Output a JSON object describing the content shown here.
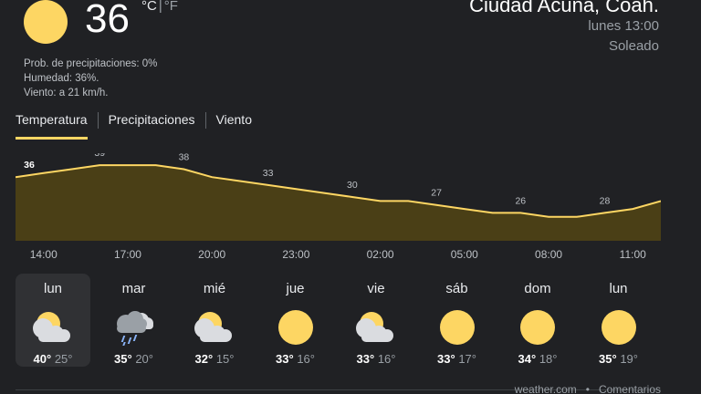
{
  "current": {
    "icon": "sun-icon",
    "temperature": "36",
    "unit_c": "°C",
    "unit_sep": "|",
    "unit_f": "°F",
    "precipitation": "Prob. de precipitaciones: 0%",
    "humidity": "Humedad: 36%.",
    "wind": "Viento: a 21 km/h."
  },
  "location": {
    "city": "Ciudad Acuña, Coah.",
    "time": "lunes 13:00",
    "condition": "Soleado"
  },
  "tabs": [
    "Temperatura",
    "Precipitaciones",
    "Viento"
  ],
  "chart_data": {
    "type": "area",
    "x": [
      "13:00",
      "14:00",
      "15:00",
      "16:00",
      "17:00",
      "18:00",
      "19:00",
      "20:00",
      "21:00",
      "22:00",
      "23:00",
      "00:00",
      "01:00",
      "02:00",
      "03:00",
      "04:00",
      "05:00",
      "06:00",
      "07:00",
      "08:00",
      "09:00",
      "10:00",
      "11:00",
      "12:00"
    ],
    "values": [
      36,
      37,
      38,
      39,
      39,
      39,
      38,
      36,
      35,
      34,
      33,
      32,
      31,
      30,
      30,
      29,
      28,
      27,
      27,
      26,
      26,
      27,
      28,
      30
    ],
    "data_labels": [
      "36",
      "39",
      "38",
      "33",
      "30",
      "27",
      "26",
      "28"
    ],
    "tick_labels": [
      "14:00",
      "17:00",
      "20:00",
      "23:00",
      "02:00",
      "05:00",
      "08:00",
      "11:00"
    ],
    "ylim": [
      15,
      42
    ],
    "line_color": "#fdd663",
    "fill_color": "#4a3f16"
  },
  "forecast": [
    {
      "day": "lun",
      "icon": "partly-cloudy-icon",
      "high": "40°",
      "low": "25°",
      "selected": true
    },
    {
      "day": "mar",
      "icon": "rain-cloud-icon",
      "high": "35°",
      "low": "20°"
    },
    {
      "day": "mié",
      "icon": "partly-cloudy-icon",
      "high": "32°",
      "low": "15°"
    },
    {
      "day": "jue",
      "icon": "sun-icon",
      "high": "33°",
      "low": "16°"
    },
    {
      "day": "vie",
      "icon": "partly-cloudy-icon",
      "high": "33°",
      "low": "16°"
    },
    {
      "day": "sáb",
      "icon": "sun-icon",
      "high": "33°",
      "low": "17°"
    },
    {
      "day": "dom",
      "icon": "sun-icon",
      "high": "34°",
      "low": "18°"
    },
    {
      "day": "lun",
      "icon": "sun-icon",
      "high": "35°",
      "low": "19°"
    }
  ],
  "footer": {
    "source": "weather.com",
    "separator": "•",
    "feedback": "Comentarios"
  }
}
